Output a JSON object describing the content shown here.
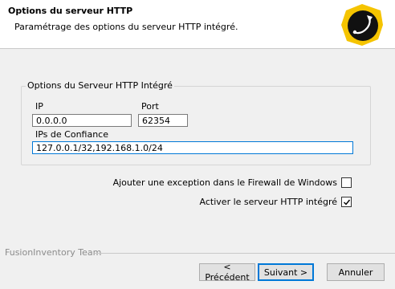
{
  "header": {
    "title": "Options du serveur HTTP",
    "subtitle": "Paramétrage des options du serveur HTTP intégré."
  },
  "logo": {
    "icon": "fusioninventory-logo-icon",
    "color": "#f5c400"
  },
  "group": {
    "title": "Options du Serveur HTTP Intégré",
    "ip_label": "IP",
    "ip_value": "0.0.0.0",
    "port_label": "Port",
    "port_value": "62354",
    "trusted_label": "IPs de Confiance",
    "trusted_value": "127.0.0.1/32,192.168.1.0/24"
  },
  "options": {
    "firewall_label": "Ajouter une exception dans le Firewall de Windows",
    "firewall_checked": false,
    "http_label": "Activer le serveur HTTP intégré",
    "http_checked": true
  },
  "footer": {
    "brand": "FusionInventory Team"
  },
  "buttons": {
    "back": "< Précédent",
    "next": "Suivant >",
    "cancel": "Annuler"
  },
  "colors": {
    "accent": "#0078d7",
    "logo_yellow": "#f5c400"
  }
}
